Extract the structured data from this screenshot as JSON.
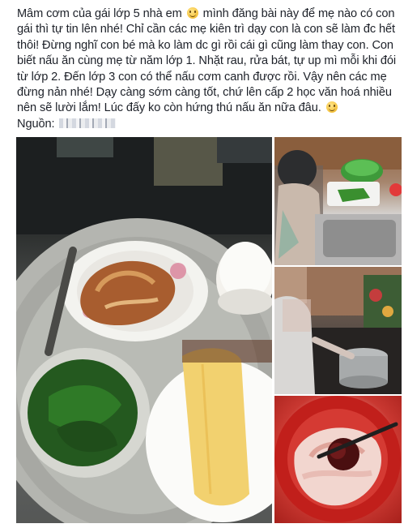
{
  "post": {
    "text": "Mâm cơm của gái lớp 5 nhà em 🙂 mình đăng bài này để mẹ nào có con gái thì tự tin lên nhé! Chỉ cần các mẹ kiên trì dạy con là con sẽ làm đc hết thôi! Đừng nghĩ con bé mà ko làm dc gì rồi cái gì cũng làm thay con. Con biết nấu ăn cùng mẹ từ năm lớp 1. Nhặt rau, rửa bát, tự up mì mỗi khi đói từ lớp 2. Đến lớp 3 con có thể nấu cơm canh được rồi. Vậy nên các mẹ đừng nản nhé! Dạy càng sớm càng tốt, chứ lên cấp 2 học văn hoá nhiều nên sẽ lười lắm! Lúc đấy ko còn hứng thú nấu ăn nữa đâu. 🙂",
    "text_part1": "Mâm cơm của gái lớp 5 nhà em",
    "text_part2": " mình đăng bài này để mẹ nào có con gái thì tự tin lên nhé! Chỉ cần các mẹ kiên trì dạy con là con sẽ làm đc hết thôi! Đừng nghĩ con bé mà ko làm dc gì rồi cái gì cũng làm thay con. Con biết nấu ăn cùng mẹ từ năm lớp 1. Nhặt rau, rửa bát, tự up mì mỗi khi đói từ lớp 2. Đến lớp 3 con có thể nấu cơm canh được rồi. Vậy nên các mẹ đừng nản nhé! Dạy càng sớm càng tốt, chứ lên cấp 2 học văn hoá nhiều nên sẽ lười lắm! Lúc đấy ko còn hứng thú nấu ăn nữa đâu.",
    "source_label": "Nguồn:",
    "emoji_icon": "smiley-icon"
  },
  "photos": {
    "count": 4,
    "items": [
      "meal-tray-photo",
      "kitchen-sink-photo",
      "stove-pot-photo",
      "meat-bowl-photo"
    ]
  },
  "colors": {
    "text": "#1d2129",
    "background": "#ffffff"
  }
}
